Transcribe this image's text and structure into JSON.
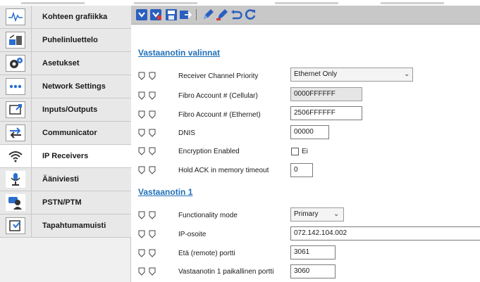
{
  "sidebar": {
    "items": [
      {
        "label": "Kohteen grafiikka",
        "icon": "waveform-icon"
      },
      {
        "label": "Puhelinluettelo",
        "icon": "phonebook-icon"
      },
      {
        "label": "Asetukset",
        "icon": "gears-icon"
      },
      {
        "label": "Network Settings",
        "icon": "dots-icon"
      },
      {
        "label": "Inputs/Outputs",
        "icon": "io-icon"
      },
      {
        "label": "Communicator",
        "icon": "arrows-icon"
      },
      {
        "label": "IP Receivers",
        "icon": "wifi-icon"
      },
      {
        "label": "Ääniviesti",
        "icon": "microphone-person-icon"
      },
      {
        "label": "PSTN/PTM",
        "icon": "phone-person-icon"
      },
      {
        "label": "Tapahtumamuisti",
        "icon": "log-icon"
      }
    ],
    "active_index": 6
  },
  "toolbar": {
    "buttons": [
      "download-icon",
      "upload-icon",
      "save-icon",
      "transfer-icon",
      "edit-icon",
      "edit-alt-icon",
      "undo-icon",
      "refresh-icon"
    ]
  },
  "section1": {
    "title": "Vastaanotin valinnat",
    "fields": {
      "priority": {
        "label": "Receiver Channel Priority",
        "value": "Ethernet Only"
      },
      "fibro_cellular": {
        "label": "Fibro Account # (Cellular)",
        "value": "0000FFFFFF"
      },
      "fibro_ethernet": {
        "label": "Fibro Account # (Ethernet)",
        "value": "2506FFFFFF"
      },
      "dnis": {
        "label": "DNIS",
        "value": "00000"
      },
      "encryption": {
        "label": "Encryption Enabled",
        "value": "Ei"
      },
      "hold_ack": {
        "label": "Hold ACK in memory timeout",
        "value": "0"
      }
    }
  },
  "section2": {
    "title": "Vastaanotin 1",
    "fields": {
      "mode": {
        "label": "Functionality mode",
        "value": "Primary"
      },
      "ip": {
        "label": "IP-osoite",
        "value": "072.142.104.002"
      },
      "remote_port": {
        "label": "Etä (remote) portti",
        "value": "3061"
      },
      "local_port": {
        "label": "Vastaanotin 1 paikallinen portti",
        "value": "3060"
      }
    }
  },
  "colors": {
    "accent": "#1e6fb8",
    "toolbar_blue": "#2b5fbf",
    "toolbar_red": "#d23a3a"
  }
}
